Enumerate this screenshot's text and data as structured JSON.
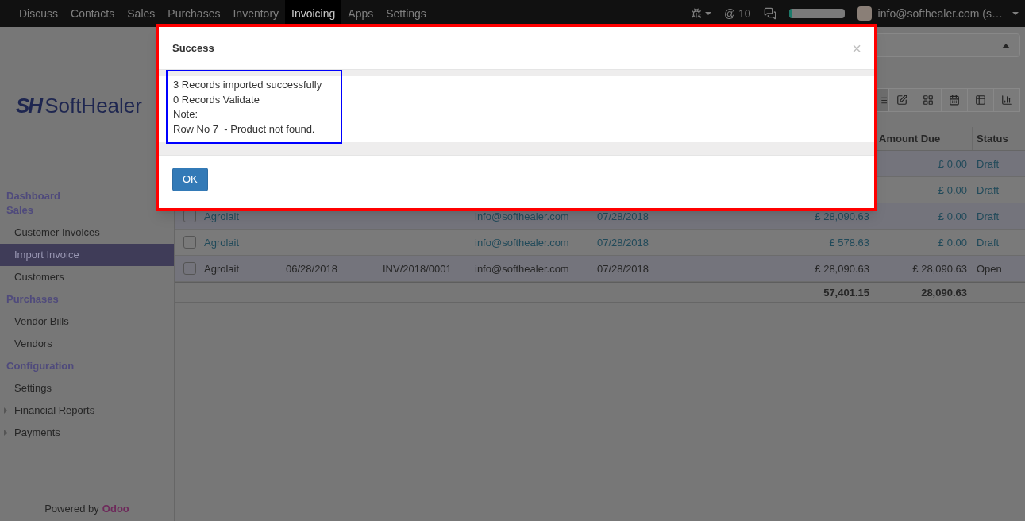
{
  "top_nav": {
    "apps": [
      {
        "label": "Discuss",
        "selected": false
      },
      {
        "label": "Contacts",
        "selected": false
      },
      {
        "label": "Sales",
        "selected": false
      },
      {
        "label": "Purchases",
        "selected": false
      },
      {
        "label": "Inventory",
        "selected": false
      },
      {
        "label": "Invoicing",
        "selected": true
      },
      {
        "label": "Apps",
        "selected": false
      },
      {
        "label": "Settings",
        "selected": false
      }
    ],
    "mentions": "@ 10",
    "progress": {
      "level": 0.06
    },
    "user": "info@softhealer.com (s…"
  },
  "sidebar": {
    "logo": {
      "mark": "SH",
      "text": "SoftHealer"
    },
    "sections": [
      {
        "title": "Dashboard"
      },
      {
        "title": "Sales",
        "items": [
          {
            "label": "Customer Invoices",
            "kind": "link",
            "selected": false
          },
          {
            "label": "Import Invoice",
            "kind": "link",
            "selected": true
          },
          {
            "label": "Customers",
            "kind": "link",
            "selected": false
          }
        ]
      },
      {
        "title": "Purchases",
        "items": [
          {
            "label": "Vendor Bills",
            "kind": "link",
            "selected": false
          },
          {
            "label": "Vendors",
            "kind": "link",
            "selected": false
          }
        ]
      },
      {
        "title": "Configuration",
        "items": [
          {
            "label": "Settings",
            "kind": "link",
            "selected": false
          },
          {
            "label": "Financial Reports",
            "kind": "folder",
            "selected": false
          },
          {
            "label": "Payments",
            "kind": "folder",
            "selected": false
          }
        ]
      }
    ],
    "footer": {
      "text": "Powered by",
      "brand": "Odoo"
    }
  },
  "table": {
    "columns": [
      "Amount Due",
      "Status"
    ],
    "rows": [
      {
        "kind": "draft",
        "amount_due": "£ 0.00",
        "status": "Draft"
      },
      {
        "kind": "draft",
        "amount_due": "£ 0.00",
        "status": "Draft"
      },
      {
        "kind": "draft",
        "checked": false,
        "customer": "Agrolait",
        "email": "info@softhealer.com",
        "due_date": "07/28/2018",
        "total": "£ 28,090.63",
        "amount_due": "£ 0.00",
        "status": "Draft"
      },
      {
        "kind": "draft",
        "checked": false,
        "customer": "Agrolait",
        "email": "info@softhealer.com",
        "due_date": "07/28/2018",
        "total": "£ 578.63",
        "amount_due": "£ 0.00",
        "status": "Draft"
      },
      {
        "kind": "open",
        "checked": false,
        "customer": "Agrolait",
        "invoice_date": "06/28/2018",
        "number": "INV/2018/0001",
        "email": "info@softhealer.com",
        "due_date": "07/28/2018",
        "total": "£ 28,090.63",
        "amount_due": "£ 28,090.63",
        "status": "Open"
      }
    ],
    "totals": {
      "total": "57,401.15",
      "amount_due": "28,090.63"
    }
  },
  "dialog": {
    "title": "Success",
    "close": "×",
    "lines": [
      "3 Records imported successfully",
      "0 Records Validate",
      "Note:",
      "Row No 7  - Product not found."
    ],
    "ok_button": "OK"
  }
}
